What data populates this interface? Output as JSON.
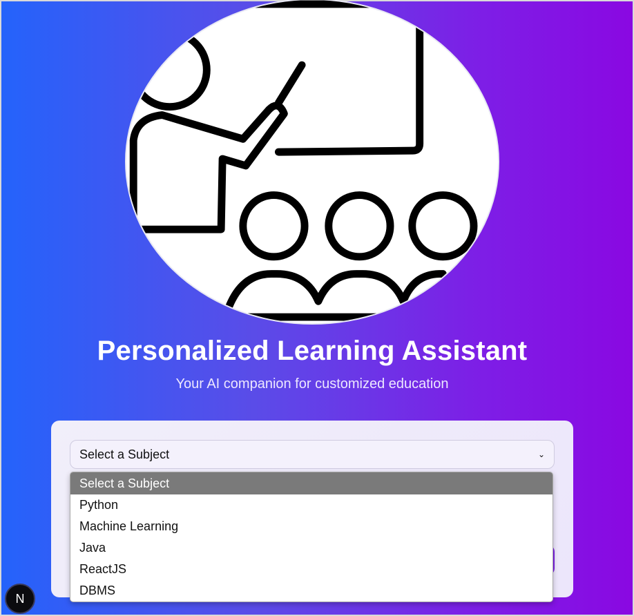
{
  "hero": {
    "icon": "teacher-classroom-illustration"
  },
  "header": {
    "title": "Personalized Learning Assistant",
    "subtitle": "Your AI companion for customized education"
  },
  "subject_select": {
    "selected": "Select a Subject",
    "options": [
      "Select a Subject",
      "Python",
      "Machine Learning",
      "Java",
      "ReactJS",
      "DBMS"
    ]
  },
  "badge": {
    "label": "N"
  },
  "colors": {
    "gradient_start": "#2463fb",
    "gradient_end": "#8a08e2",
    "button": "#7d1fe6",
    "option_highlight": "#7a7a7a"
  }
}
